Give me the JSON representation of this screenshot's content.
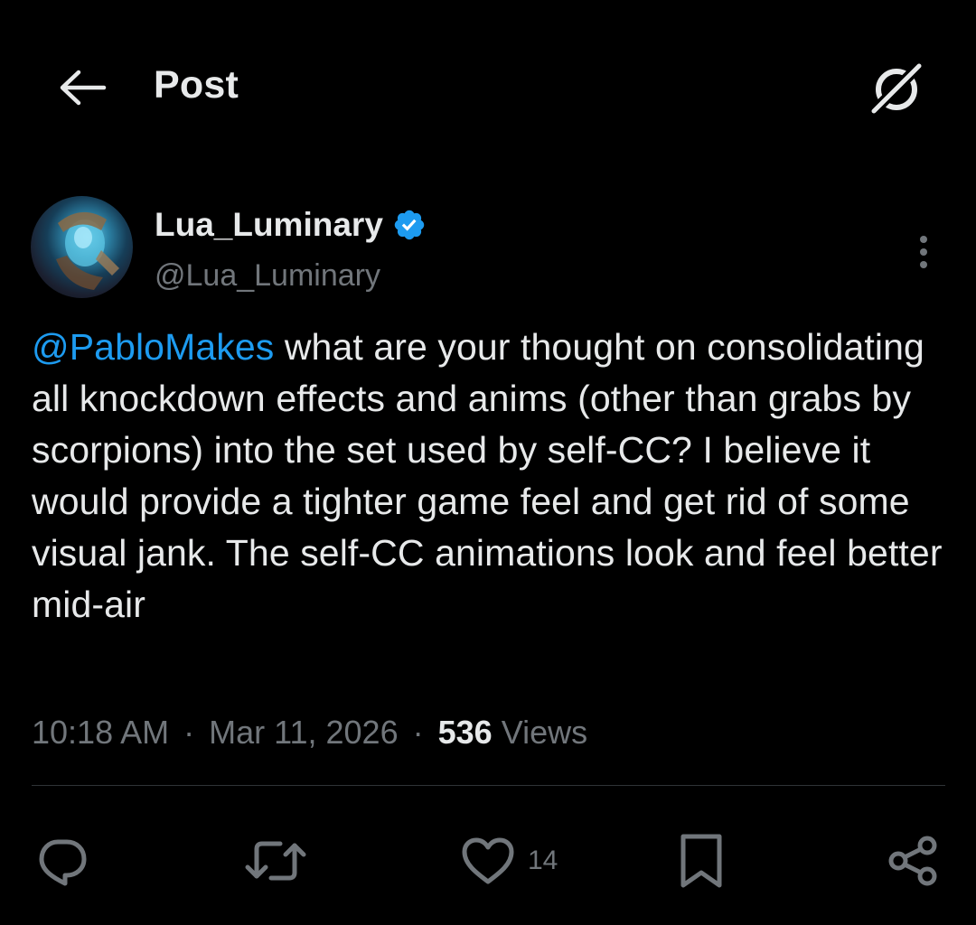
{
  "header": {
    "title": "Post"
  },
  "author": {
    "display_name": "Lua_Luminary",
    "handle": "@Lua_Luminary",
    "verified": true
  },
  "post": {
    "mention": "@PabloMakes",
    "text": " what are your thought on consolidating all knockdown effects and anims (other than grabs by scorpions) into the set used by self-CC? I believe it would provide a tighter game feel and get rid of some visual jank. The self-CC animations look and feel better mid-air"
  },
  "meta": {
    "time": "10:18 AM",
    "separator": "·",
    "date": "Mar 11, 2026",
    "views_count": "536",
    "views_label": "Views"
  },
  "actions": {
    "like_count": "14"
  },
  "colors": {
    "background": "#000000",
    "text": "#e7e9ea",
    "muted": "#71767b",
    "accent": "#1d9bf0",
    "divider": "#2f3336"
  },
  "icons": {
    "back": "arrow-left-icon",
    "grok": "grok-icon",
    "verified": "verified-badge-icon",
    "more": "more-vertical-icon",
    "reply": "reply-icon",
    "repost": "repost-icon",
    "like": "heart-icon",
    "bookmark": "bookmark-icon",
    "share": "share-icon"
  }
}
